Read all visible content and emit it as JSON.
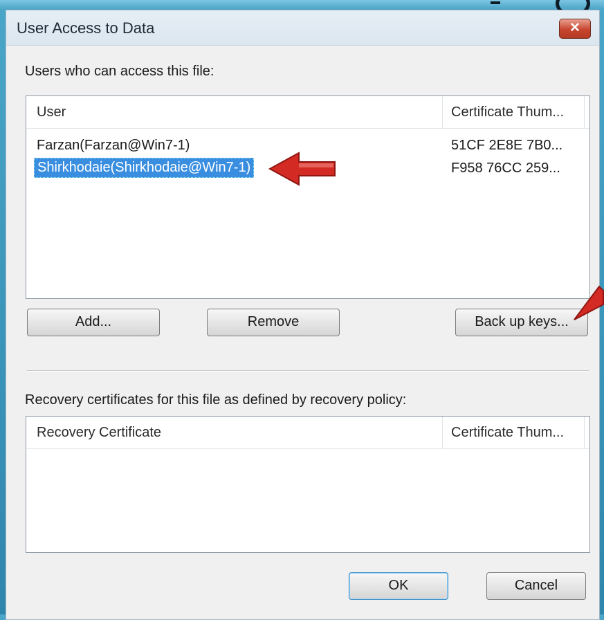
{
  "window": {
    "title": "User Access to Data",
    "close_glyph": "✕"
  },
  "users_section": {
    "label": "Users who can access this file:",
    "columns": [
      "User",
      "Certificate Thum..."
    ],
    "rows": [
      {
        "user": "Farzan(Farzan@Win7-1)",
        "thumbprint": "51CF 2E8E 7B0..."
      },
      {
        "user": "Shirkhodaie(Shirkhodaie@Win7-1)",
        "thumbprint": "F958 76CC 259..."
      }
    ],
    "selected_row": 1
  },
  "buttons": {
    "add": "Add...",
    "remove": "Remove",
    "backup": "Back up keys...",
    "ok": "OK",
    "cancel": "Cancel"
  },
  "recovery_section": {
    "label": "Recovery certificates for this file as defined by recovery policy:",
    "columns": [
      "Recovery Certificate",
      "Certificate Thum..."
    ]
  },
  "colors": {
    "selection": "#3a8ee0",
    "annotation_arrow": "#d42a24"
  }
}
